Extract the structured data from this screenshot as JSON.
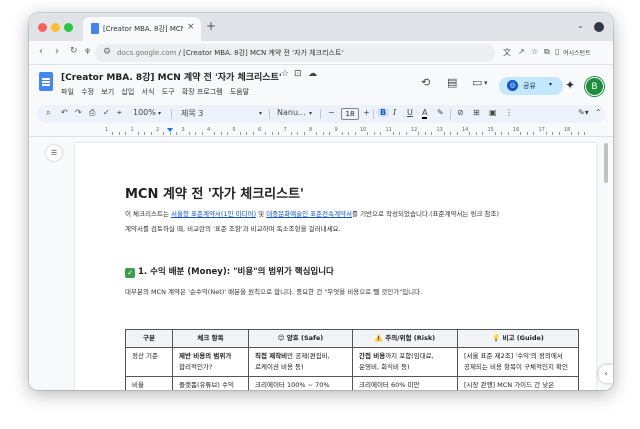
{
  "browser": {
    "tab_title": "[Creator MBA. 8강] MCN 계",
    "tab_close": "×",
    "new_tab": "+",
    "url_domain": "docs.google.com",
    "url_path": " / [Creator MBA. 8강] MCN 계약 전 '자가 체크리스트'",
    "summary_label": "여시스턴트"
  },
  "docs": {
    "title": "[Creator MBA. 8강] MCN 계약 전 '자가 체크리스트'",
    "menu": [
      "파일",
      "수정",
      "보기",
      "삽입",
      "서식",
      "도구",
      "확장 프로그램",
      "도움말"
    ],
    "share_label": "공유",
    "avatar_letter": "B"
  },
  "toolbar": {
    "zoom": "100%",
    "style": "제목 3",
    "font": "Nanu...",
    "font_size": "18",
    "bold": "B",
    "italic": "I",
    "underline": "U",
    "text_color": "A"
  },
  "ruler": {
    "numbers": [
      "1",
      "1",
      "2",
      "3",
      "4",
      "5",
      "6",
      "7",
      "8",
      "9",
      "10",
      "11",
      "12",
      "13",
      "14",
      "15",
      "16",
      "17",
      "18"
    ]
  },
  "document": {
    "heading": "MCN 계약 전 '자가 체크리스트'",
    "intro_prefix": "이 체크리스트는 ",
    "link1": "서울형 표준계약서(1인 미디어)",
    "intro_mid": " 및 ",
    "link2": "대중문화예술인 표준전속계약서",
    "intro_suffix": "를 기반으로 작성되었습니다.(표준계약서는 링크 참조)",
    "intro_line2": "계약서를 검토하실 때, 비교란의 '표준 조항'과 비교하며 독소조항을 걸러내세요.",
    "section1_heading": "1. 수익 배분 (Money): \"비용\"의 범위가 핵심입니다",
    "section1_body": "대부분의 MCN 계약은 '순수익(Net)' 배분을 원칙으로 합니다. 중요한 건 \"무엇을 비용으로 뺄 것인가\"입니다.",
    "table": {
      "headers": [
        "구분",
        "체크 항목",
        "😊 양호 (Safe)",
        "⚠️ 주의/위험 (Risk)",
        "💡 비고 (Guide)"
      ],
      "rows": [
        {
          "col1": "정산 기준",
          "col2_l1": "제반 비용의 범위가",
          "col2_l2": "합리적인가?",
          "col3_bold": "직접 제작비",
          "col3_rest": "만 공제(편집비,",
          "col3_l2": "로케이션 비용 등)",
          "col4_bold": "간접 비용",
          "col4_rest": "까지 포함(임대료,",
          "col4_l2": "운영비, 회식비 등)",
          "col5_l1": "[서울 표준 제2조] '수익'의 정의에서",
          "col5_l2": "공제되는 비용 항목이 구체적인지 확인"
        },
        {
          "col1": "비율",
          "col2_l1": "플랫폼(유튜브) 수익",
          "col3_l1": "크리에이터 100% ~ 70%",
          "col4_l1": "크리에이터 60% 미만",
          "col5_l1": "[시장 관행] MCN 가이드 간 낮은"
        }
      ]
    }
  }
}
